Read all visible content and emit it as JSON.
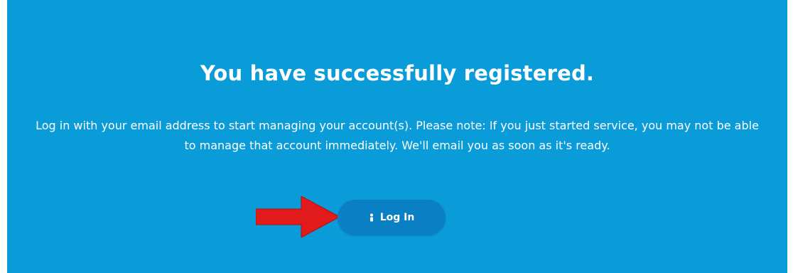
{
  "registration": {
    "title": "You have successfully registered.",
    "message": "Log in with your email address to start managing your account(s). Please note: If you just started service, you may not be able to manage that account immediately. We'll email you as soon as it's ready.",
    "login_label": "Log In"
  },
  "icons": {
    "login_icon": "person-icon",
    "annotation_arrow": "red-arrow-icon"
  },
  "colors": {
    "background": "#0a9bd9",
    "button": "#0a7fc4",
    "text": "#ffffff",
    "arrow": "#e11b1b"
  }
}
